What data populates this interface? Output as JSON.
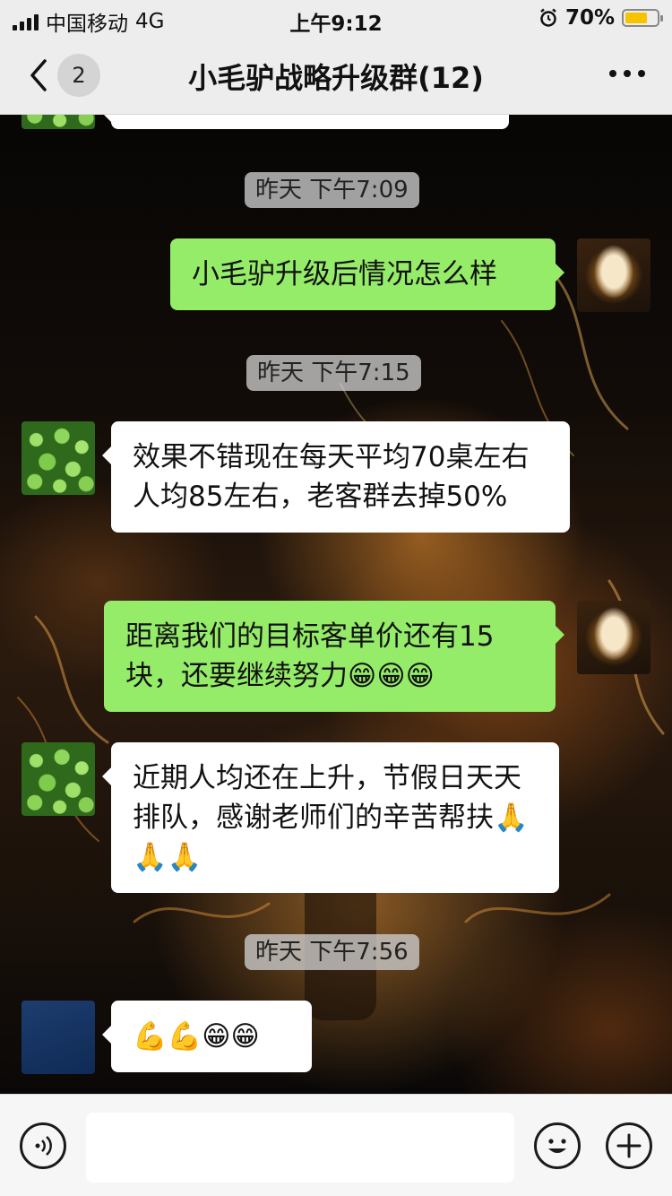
{
  "status_bar": {
    "carrier": "中国移动",
    "network": "4G",
    "time": "上午9:12",
    "battery_percent_text": "70%",
    "battery_level": 0.7,
    "alarm_icon": "alarm-clock-icon",
    "signal_icon": "signal-bars-icon"
  },
  "nav": {
    "back_icon": "chevron-left-icon",
    "unread_badge": "2",
    "title": "小毛驴战略升级群(12)",
    "more_icon": "ellipsis-icon"
  },
  "messages": [
    {
      "type": "timestamp",
      "text": "昨天 下午7:09"
    },
    {
      "type": "message",
      "direction": "outgoing",
      "avatar": "fire-avatar",
      "text": "小毛驴升级后情况怎么样",
      "emojis": []
    },
    {
      "type": "timestamp",
      "text": "昨天 下午7:15"
    },
    {
      "type": "message",
      "direction": "incoming",
      "avatar": "green-avatar",
      "text": "效果不错现在每天平均70桌左右人均85左右，老客群去掉50%",
      "emojis": []
    },
    {
      "type": "message",
      "direction": "outgoing",
      "avatar": "fire-avatar",
      "text": "距离我们的目标客单价还有15块，还要继续努力",
      "emojis": [
        "😁",
        "😁",
        "😁"
      ]
    },
    {
      "type": "message",
      "direction": "incoming",
      "avatar": "green-avatar",
      "text": "近期人均还在上升，节假日天天排队，感谢老师们的辛苦帮扶",
      "emojis": [
        "🙏",
        "🙏",
        "🙏"
      ]
    },
    {
      "type": "timestamp",
      "text": "昨天 下午7:56"
    },
    {
      "type": "message",
      "direction": "incoming",
      "avatar": "blue-avatar",
      "text": "",
      "emojis": [
        "💪",
        "💪",
        "😁",
        "😁"
      ]
    }
  ],
  "input_bar": {
    "voice_icon": "voice-icon",
    "input_value": "",
    "emoji_icon": "emoji-face-icon",
    "plus_icon": "plus-icon"
  },
  "colors": {
    "outgoing_bubble": "#95ec69",
    "incoming_bubble": "#ffffff",
    "bar_background": "#ededed"
  }
}
